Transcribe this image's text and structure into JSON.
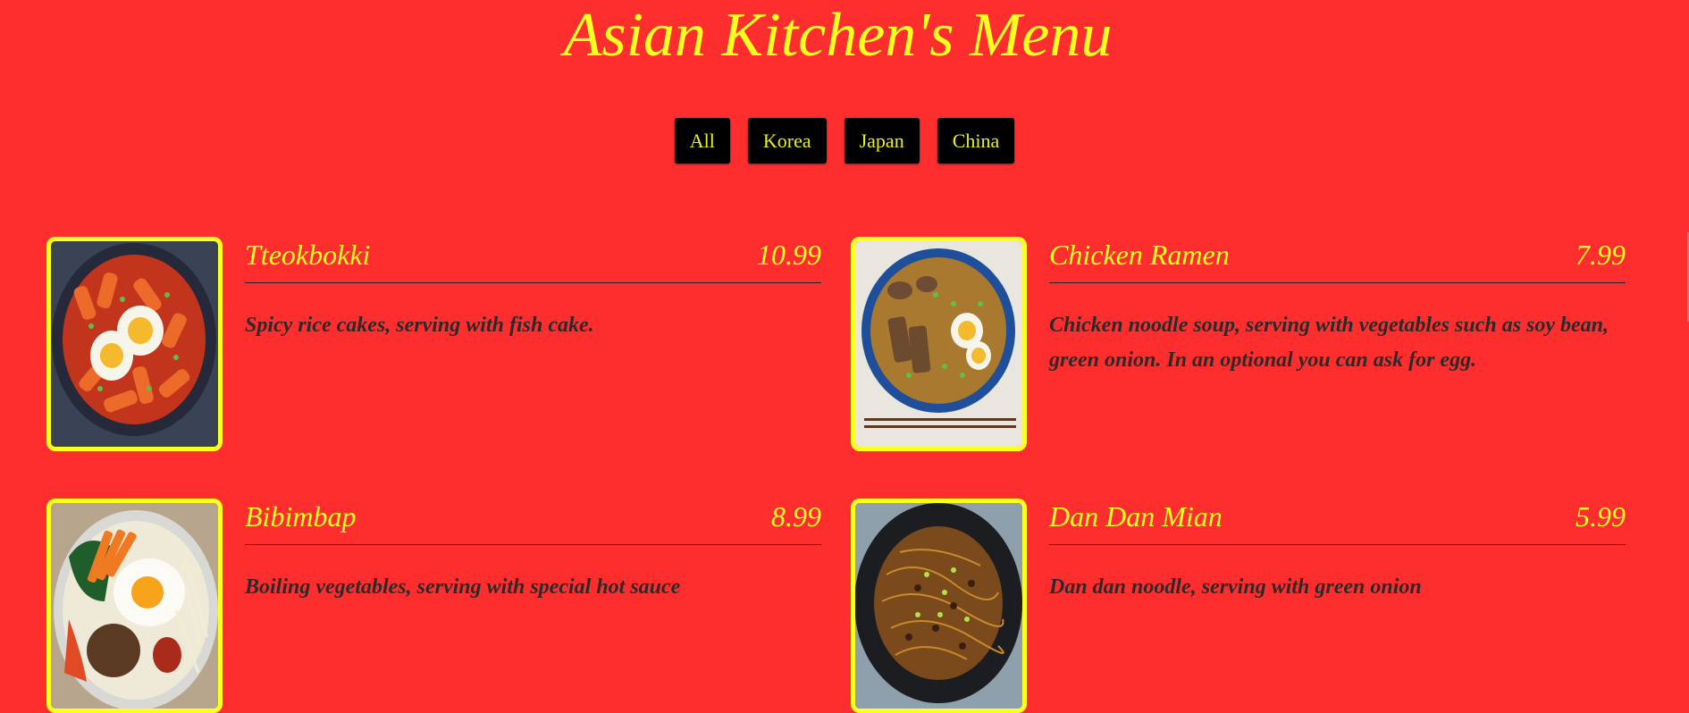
{
  "page": {
    "title": "Asian Kitchen's Menu",
    "background_color": "#ff2e2e",
    "accent_color": "#ffff22"
  },
  "filters": [
    {
      "label": "All"
    },
    {
      "label": "Korea"
    },
    {
      "label": "Japan"
    },
    {
      "label": "China"
    }
  ],
  "menu_items": [
    {
      "name": "Tteokbokki",
      "price": "10.99",
      "description": "Spicy rice cakes, serving with fish cake.",
      "photo": "tteokbokki-photo"
    },
    {
      "name": "Chicken Ramen",
      "price": "7.99",
      "description": "Chicken noodle soup, serving with vegetables such as soy bean, green onion. In an optional you can ask for egg.",
      "photo": "chicken-ramen-photo"
    },
    {
      "name": "Bibimbap",
      "price": "8.99",
      "description": "Boiling vegetables, serving with special hot sauce",
      "photo": "bibimbap-photo"
    },
    {
      "name": "Dan Dan Mian",
      "price": "5.99",
      "description": "Dan dan noodle, serving with green onion",
      "photo": "dan-dan-mian-photo"
    }
  ]
}
